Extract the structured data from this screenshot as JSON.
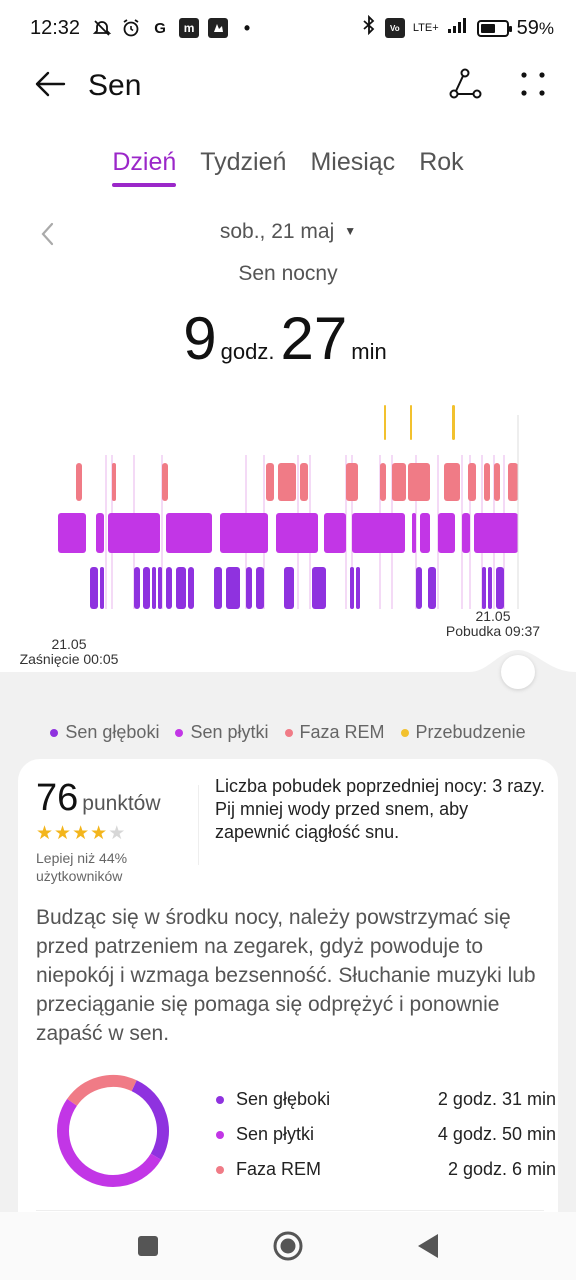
{
  "status_bar": {
    "time": "12:32",
    "left_icons": [
      "mute-icon",
      "alarm-icon",
      "g-icon",
      "m-icon",
      "app-icon"
    ],
    "network": "LTE+",
    "battery_level": 0.59,
    "battery_text": "59",
    "battery_unit": "%"
  },
  "app_bar": {
    "title": "Sen",
    "actions": [
      "share-icon",
      "more-icon"
    ]
  },
  "tabs": [
    {
      "label": "Dzień",
      "active": true
    },
    {
      "label": "Tydzień",
      "active": false
    },
    {
      "label": "Miesiąc",
      "active": false
    },
    {
      "label": "Rok",
      "active": false
    }
  ],
  "date": {
    "label": "sob., 21 maj"
  },
  "summary": {
    "subtitle": "Sen nocny",
    "hours": "9",
    "hours_unit": "godz.",
    "minutes": "27",
    "minutes_unit": "min"
  },
  "chart_labels": {
    "start_date": "21.05",
    "start_label": "Zaśnięcie 00:05",
    "end_date": "21.05",
    "end_label": "Pobudka 09:37"
  },
  "colors": {
    "deep": "#8f32df",
    "light": "#c236e6",
    "rem": "#f07b86",
    "awake": "#f2c12e",
    "accent": "#9b27c9"
  },
  "legend": [
    {
      "label": "Sen głęboki",
      "color": "#8f32df"
    },
    {
      "label": "Sen płytki",
      "color": "#c236e6"
    },
    {
      "label": "Faza REM",
      "color": "#f07b86"
    },
    {
      "label": "Przebudzenie",
      "color": "#f2c12e"
    }
  ],
  "score": {
    "value": "76",
    "unit": "punktów",
    "stars": 4,
    "max_stars": 5,
    "comparison": "Lepiej niż 44% użytkowników"
  },
  "wake_message": "Liczba pobudek poprzedniej nocy: 3 razy. Pij mniej wody przed snem, aby zapewnić ciągłość snu.",
  "tip": "Budząc się w środku nocy, należy powstrzymać się przed patrzeniem na zegarek, gdyż powoduje to niepokój i wzmaga bezsenność. Słuchanie muzyki lub przeciąganie się pomaga się odprężyć i ponownie zapaść w sen.",
  "breakdown": [
    {
      "label": "Sen głęboki",
      "value": "2 godz. 31 min",
      "minutes": 151,
      "color": "#8f32df"
    },
    {
      "label": "Sen płytki",
      "value": "4 godz. 50 min",
      "minutes": 290,
      "color": "#c236e6"
    },
    {
      "label": "Faza REM",
      "value": "2 godz. 6 min",
      "minutes": 126,
      "color": "#f07b86"
    }
  ],
  "nav": [
    "recents-button",
    "home-button",
    "back-button"
  ]
}
